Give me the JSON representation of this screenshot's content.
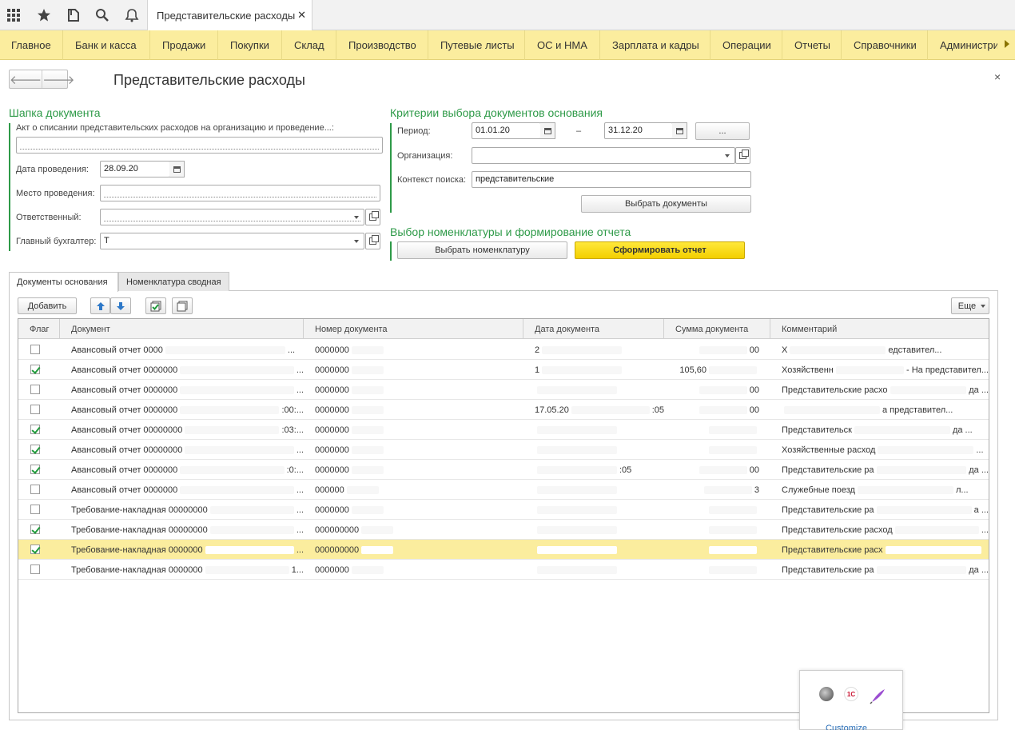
{
  "window": {
    "tab_title": "Представительские расходы",
    "tab_close": "✕"
  },
  "menu": {
    "items": [
      "Главное",
      "Банк и касса",
      "Продажи",
      "Покупки",
      "Склад",
      "Производство",
      "Путевые листы",
      "ОС и НМА",
      "Зарплата и кадры",
      "Операции",
      "Отчеты",
      "Справочники"
    ],
    "overflow_item": "Администрирование"
  },
  "icons": {
    "apps": "grid-icon",
    "favorites": "star-icon",
    "history": "history-icon",
    "search": "search-icon",
    "notifications": "bell-icon"
  },
  "form": {
    "title": "Представительские расходы",
    "close": "×",
    "header_group": {
      "title": "Шапка документа",
      "act_label": "Акт о списании представительских расходов на организацию и проведение...:",
      "act_value": "",
      "date_label": "Дата проведения:",
      "date_value": "28.09.20",
      "place_label": "Место проведения:",
      "place_value": "",
      "responsible_label": "Ответственный:",
      "responsible_value": "",
      "accountant_label": "Главный бухгалтер:",
      "accountant_value": "Т"
    },
    "criteria_group": {
      "title": "Критерии выбора документов основания",
      "period_label": "Период:",
      "period_from": "01.01.20",
      "period_dash": "–",
      "period_to": "31.12.20",
      "period_button": "...",
      "org_label": "Организация:",
      "org_value": "",
      "context_label": "Контекст поиска:",
      "context_value": "представительские",
      "select_docs_button": "Выбрать документы"
    },
    "nomenclature_group": {
      "title": "Выбор номенклатуры  и формирование отчета",
      "select_nom_button": "Выбрать номенклатуру",
      "report_button": "Сформировать отчет"
    }
  },
  "tabs": [
    {
      "label": "Документы основания",
      "active": true
    },
    {
      "label": "Номенклатура сводная",
      "active": false
    }
  ],
  "toolbar": {
    "add_label": "Добавить",
    "more_label": "Еще"
  },
  "table": {
    "columns": [
      "Флаг",
      "Документ",
      "Номер документа",
      "Дата документа",
      "Сумма документа",
      "Комментарий"
    ],
    "rows": [
      {
        "flag": false,
        "doc": "Авансовый отчет 0000",
        "doc_tail": "...",
        "number": "0000000",
        "date": "2",
        "date_tail": "",
        "sum": "",
        "sum_tail": "00",
        "comment": "Х",
        "comment_tail": "едставител..."
      },
      {
        "flag": true,
        "doc": "Авансовый отчет 0000000",
        "doc_tail": "...",
        "number": "0000000",
        "date": "1",
        "date_tail": "",
        "sum": "105,60",
        "sum_tail": "",
        "comment": "Хозяйственн",
        "comment_tail": "- На представител..."
      },
      {
        "flag": false,
        "doc": "Авансовый отчет 0000000",
        "doc_tail": "...",
        "number": "0000000",
        "date": "",
        "date_tail": "",
        "sum": "",
        "sum_tail": "00",
        "comment": "Представительские расхо",
        "comment_tail": "да ..."
      },
      {
        "flag": false,
        "doc": "Авансовый отчет 0000000",
        "doc_tail": ":00:...",
        "number": "0000000",
        "date": "17.05.20",
        "date_tail": ":05",
        "sum": "",
        "sum_tail": "00",
        "comment": "",
        "comment_tail": "а представител..."
      },
      {
        "flag": true,
        "doc": "Авансовый отчет 00000000",
        "doc_tail": ":03:...",
        "number": "0000000",
        "date": "",
        "date_tail": "",
        "sum": "",
        "sum_tail": "",
        "comment": "Представительск",
        "comment_tail": "да ..."
      },
      {
        "flag": true,
        "doc": "Авансовый отчет 00000000",
        "doc_tail": "...",
        "number": "0000000",
        "date": "",
        "date_tail": "",
        "sum": "",
        "sum_tail": "",
        "comment": "Хозяйственные расход",
        "comment_tail": "..."
      },
      {
        "flag": true,
        "doc": "Авансовый отчет 0000000",
        "doc_tail": ":0:...",
        "number": "0000000",
        "date": "",
        "date_tail": ":05",
        "sum": "",
        "sum_tail": "00",
        "comment": "Представительские ра",
        "comment_tail": "да ..."
      },
      {
        "flag": false,
        "doc": "Авансовый отчет 0000000",
        "doc_tail": "...",
        "number": "000000",
        "date": "",
        "date_tail": "",
        "sum": "",
        "sum_tail": "3",
        "comment": "Служебные поезд",
        "comment_tail": "л..."
      },
      {
        "flag": false,
        "doc": "Требование-накладная 00000000",
        "doc_tail": "...",
        "number": "0000000",
        "date": "",
        "date_tail": "",
        "sum": "",
        "sum_tail": "",
        "comment": "Представительские ра",
        "comment_tail": "а ..."
      },
      {
        "flag": true,
        "doc": "Требование-накладная 00000000",
        "doc_tail": "...",
        "number": "000000000",
        "date": "",
        "date_tail": "",
        "sum": "",
        "sum_tail": "",
        "comment": "Представительские расход",
        "comment_tail": "..."
      },
      {
        "flag": true,
        "doc": "Требование-накладная 0000000",
        "doc_tail": "...",
        "number": "000000000",
        "date": "",
        "date_tail": "",
        "sum": "",
        "sum_tail": "",
        "comment": "Представительские расх",
        "comment_tail": ""
      },
      {
        "flag": false,
        "doc": "Требование-накладная 0000000",
        "doc_tail": "1...",
        "number": "0000000",
        "date": "",
        "date_tail": "",
        "sum": "",
        "sum_tail": "",
        "comment": "Представительские ра",
        "comment_tail": "да ..."
      }
    ],
    "selected_row": 10
  },
  "customize": {
    "label": "Customize"
  },
  "colors": {
    "menu_bg": "#fbed9e",
    "accent_green": "#2e9a48",
    "report_button": "#ffe000",
    "selected_row": "#fbed9e"
  }
}
